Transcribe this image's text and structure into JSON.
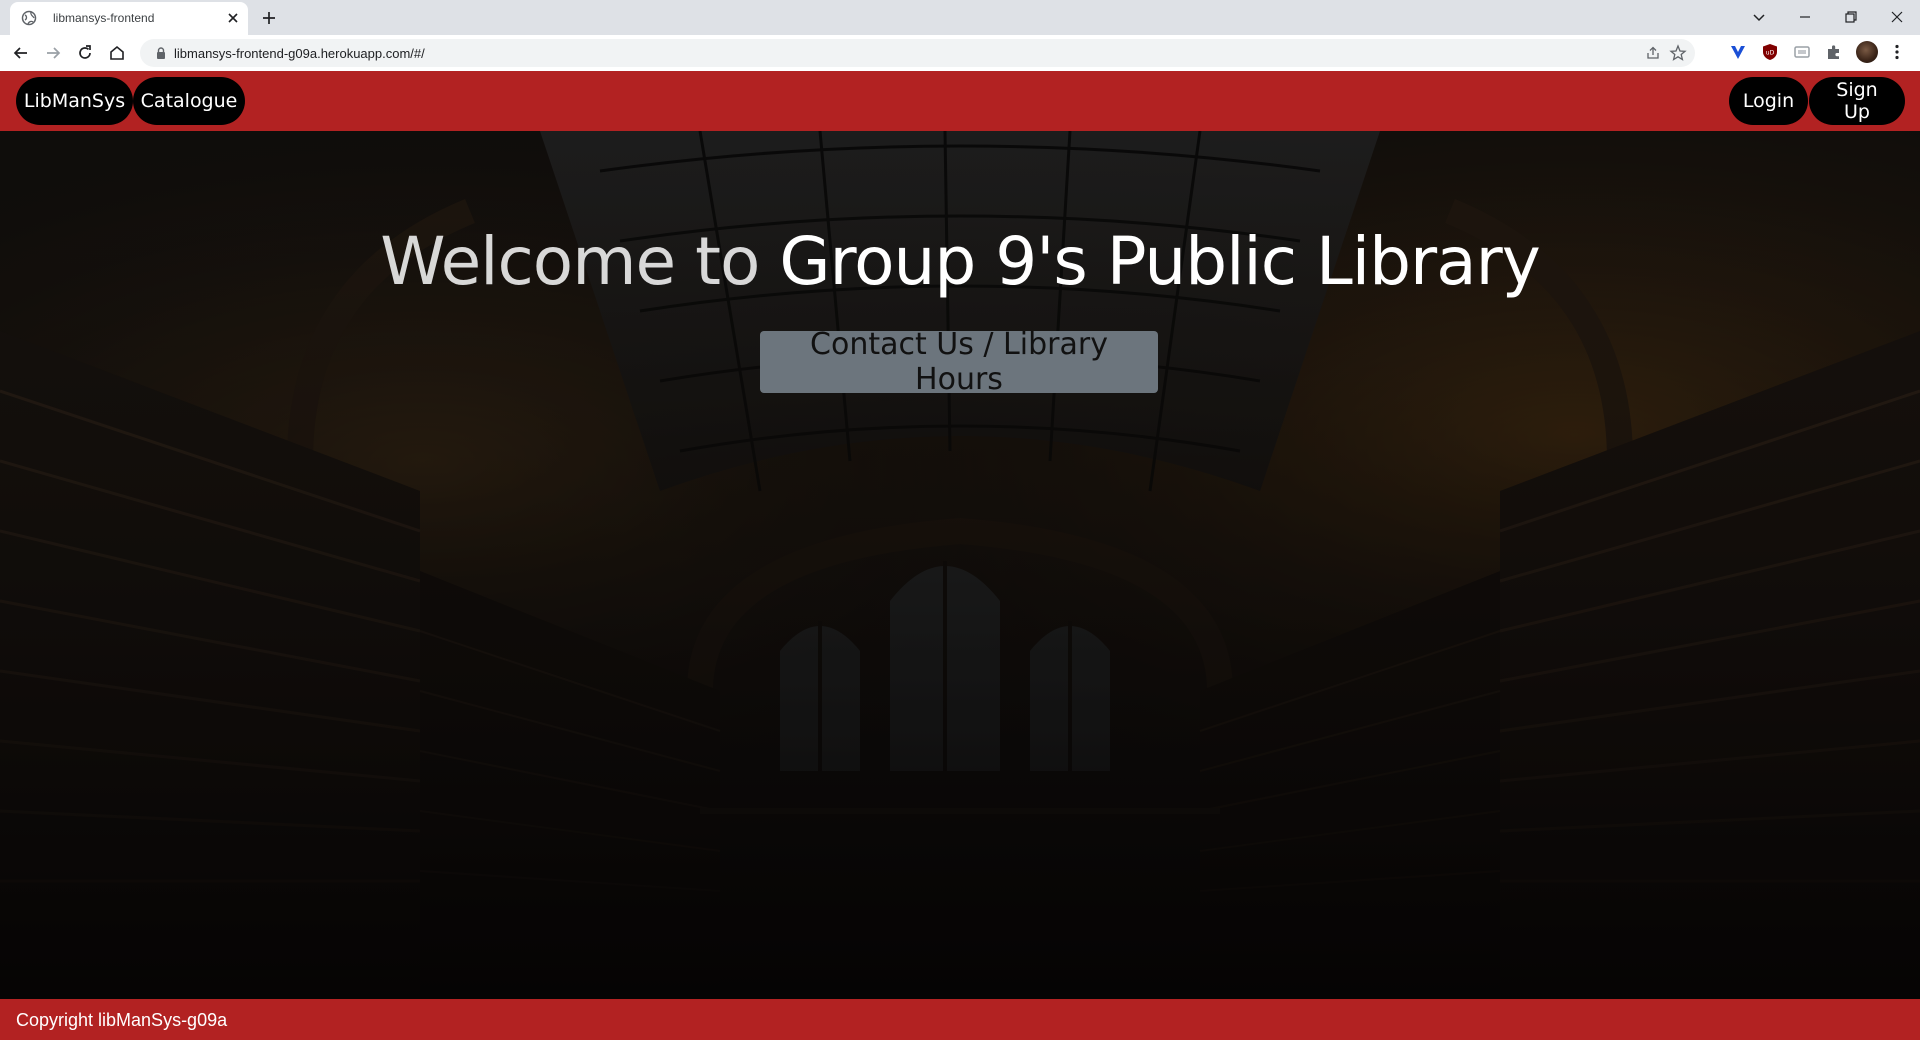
{
  "browser": {
    "tab_title": "libmansys-frontend",
    "url": "libmansys-frontend-g09a.herokuapp.com/#/"
  },
  "navbar": {
    "brand": "LibManSys",
    "catalogue": "Catalogue",
    "login": "Login",
    "signup": "Sign Up",
    "color": "#b22222"
  },
  "hero": {
    "title_part1": "Welcome to ",
    "title_part2": "Group 9's Public Library",
    "button": "Contact Us / Library Hours"
  },
  "footer": {
    "text": "Copyright libManSys-g09a"
  }
}
